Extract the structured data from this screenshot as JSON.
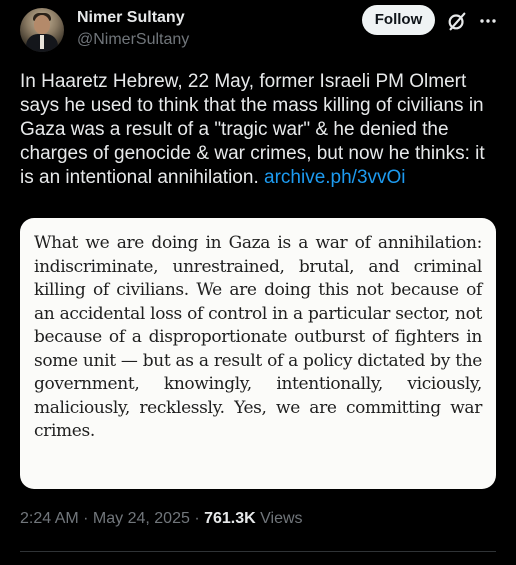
{
  "author": {
    "display_name": "Nimer Sultany",
    "handle": "@NimerSultany"
  },
  "actions": {
    "follow_label": "Follow",
    "grok_icon": "grok-icon",
    "more_icon": "more-options-icon"
  },
  "post": {
    "text": "In Haaretz Hebrew, 22 May, former Israeli PM Olmert says he used to think that the mass killing of civilians in Gaza was a result of a \"tragic war\" & he denied the charges of genocide & war crimes, but now he thinks: it is an intentional annihilation. ",
    "link_text": "archive.ph/3vvOi"
  },
  "quote": {
    "text": "What we are doing in Gaza is a war of annihilation: indiscriminate, unrestrained, brutal, and criminal killing of civilians. We are doing this not because of an accidental loss of control in a particular sector, not because of a disproportionate outburst of fighters in some unit — but as a result of a policy dictated by the government, knowingly, intentionally, viciously, maliciously, recklessly. Yes, we are committing war crimes."
  },
  "meta": {
    "time": "2:24 AM",
    "sep1": " · ",
    "date": "May 24, 2025",
    "sep2": " · ",
    "views_count": "761.3K",
    "views_label": " Views"
  },
  "colors": {
    "background": "#000000",
    "text": "#e7e9ea",
    "secondary": "#71767b",
    "link": "#1d9bf0",
    "quote_card": "#fbfbf9"
  }
}
